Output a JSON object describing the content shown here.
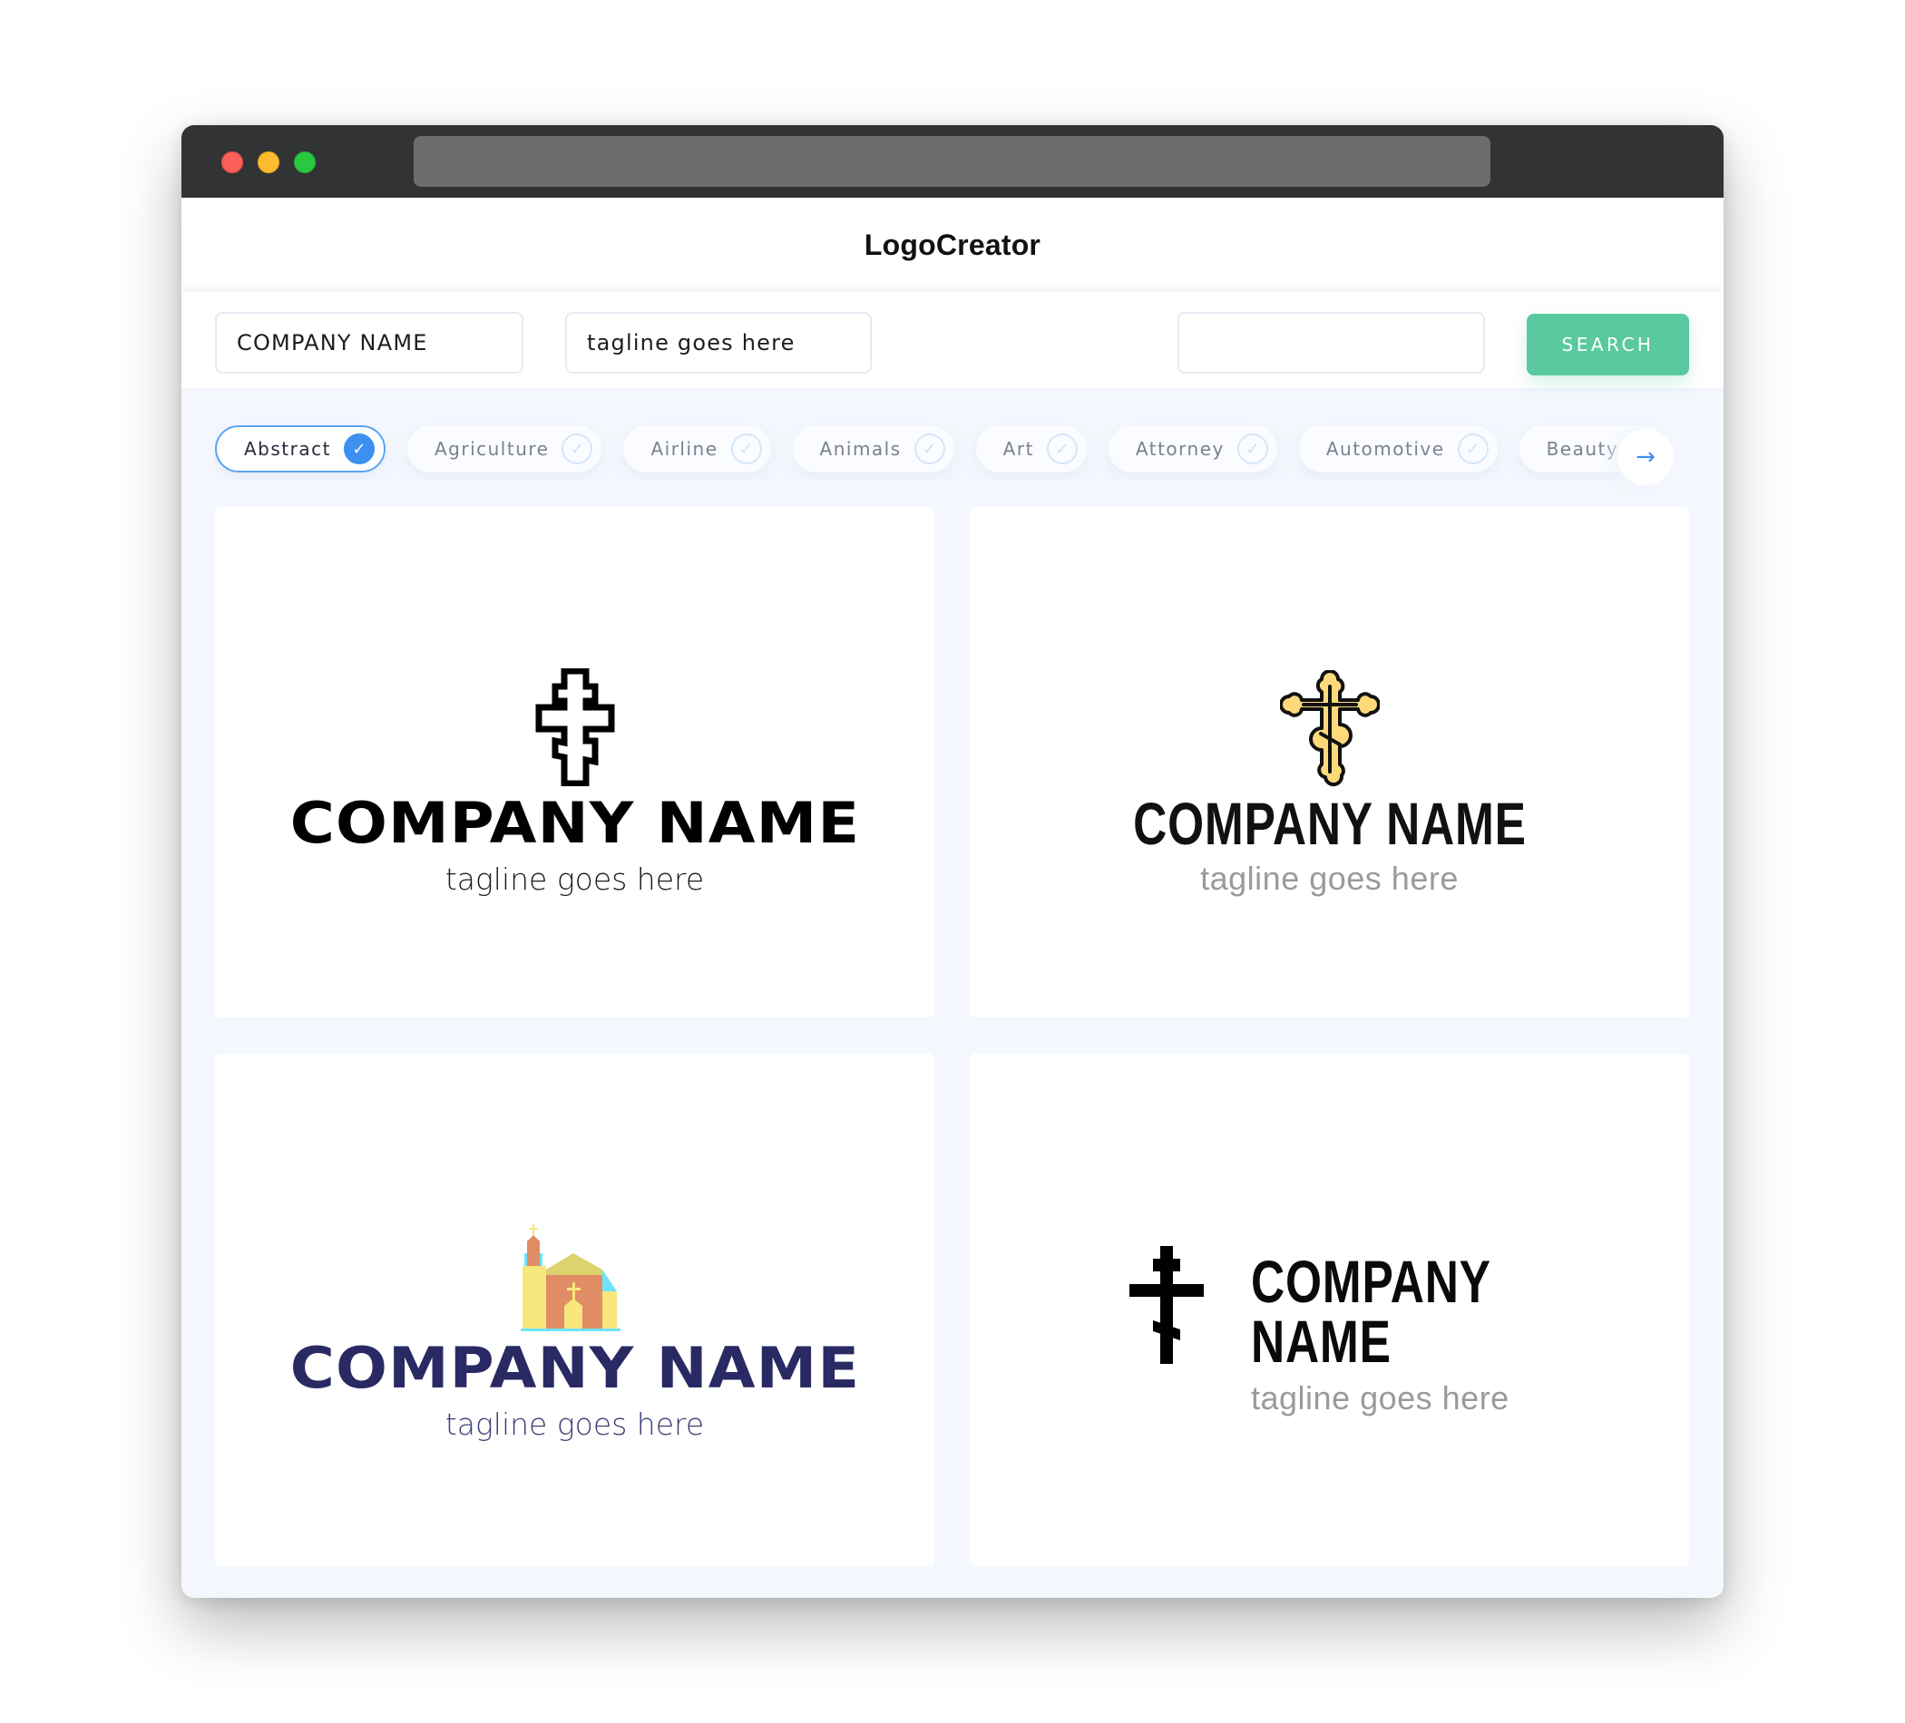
{
  "window": {
    "controls": [
      "close",
      "minimize",
      "maximize"
    ],
    "address_bar": ""
  },
  "header": {
    "brand": "LogoCreator"
  },
  "search": {
    "company_value": "COMPANY NAME",
    "tagline_value": "tagline goes here",
    "query_value": "",
    "query_placeholder": "",
    "button_label": "SEARCH"
  },
  "filters": {
    "chips": [
      {
        "label": "Abstract",
        "selected": true
      },
      {
        "label": "Agriculture",
        "selected": false
      },
      {
        "label": "Airline",
        "selected": false
      },
      {
        "label": "Animals",
        "selected": false
      },
      {
        "label": "Art",
        "selected": false
      },
      {
        "label": "Attorney",
        "selected": false
      },
      {
        "label": "Automotive",
        "selected": false
      },
      {
        "label": "Beauty",
        "selected": false
      }
    ],
    "check_icon": "✓",
    "next_icon": "→"
  },
  "cards": [
    {
      "icon": "orthodox-cross-outline-icon",
      "company_name": "COMPANY NAME",
      "tagline": "tagline goes here",
      "name_color": "#000000",
      "tagline_color": "#1a1a1a",
      "layout": "stacked"
    },
    {
      "icon": "orthodox-cross-ornate-yellow-icon",
      "company_name": "COMPANY NAME",
      "tagline": "tagline goes here",
      "name_color": "#111111",
      "tagline_color": "#9a9a9a",
      "icon_fill": "#fdd97a",
      "layout": "stacked"
    },
    {
      "icon": "church-building-icon",
      "company_name": "COMPANY NAME",
      "tagline": "tagline goes here",
      "name_color": "#292a63",
      "tagline_color": "#3b3d75",
      "layout": "stacked"
    },
    {
      "icon": "orthodox-cross-solid-icon",
      "company_name": "COMPANY NAME",
      "tagline": "tagline goes here",
      "name_color": "#0a0a0a",
      "tagline_color": "#9a9a9a",
      "layout": "inline"
    }
  ],
  "colors": {
    "accent": "#3d8ff0",
    "search_button": "#5ac9a0",
    "titlebar": "#323335",
    "content_bg": "#f4f7fd"
  }
}
